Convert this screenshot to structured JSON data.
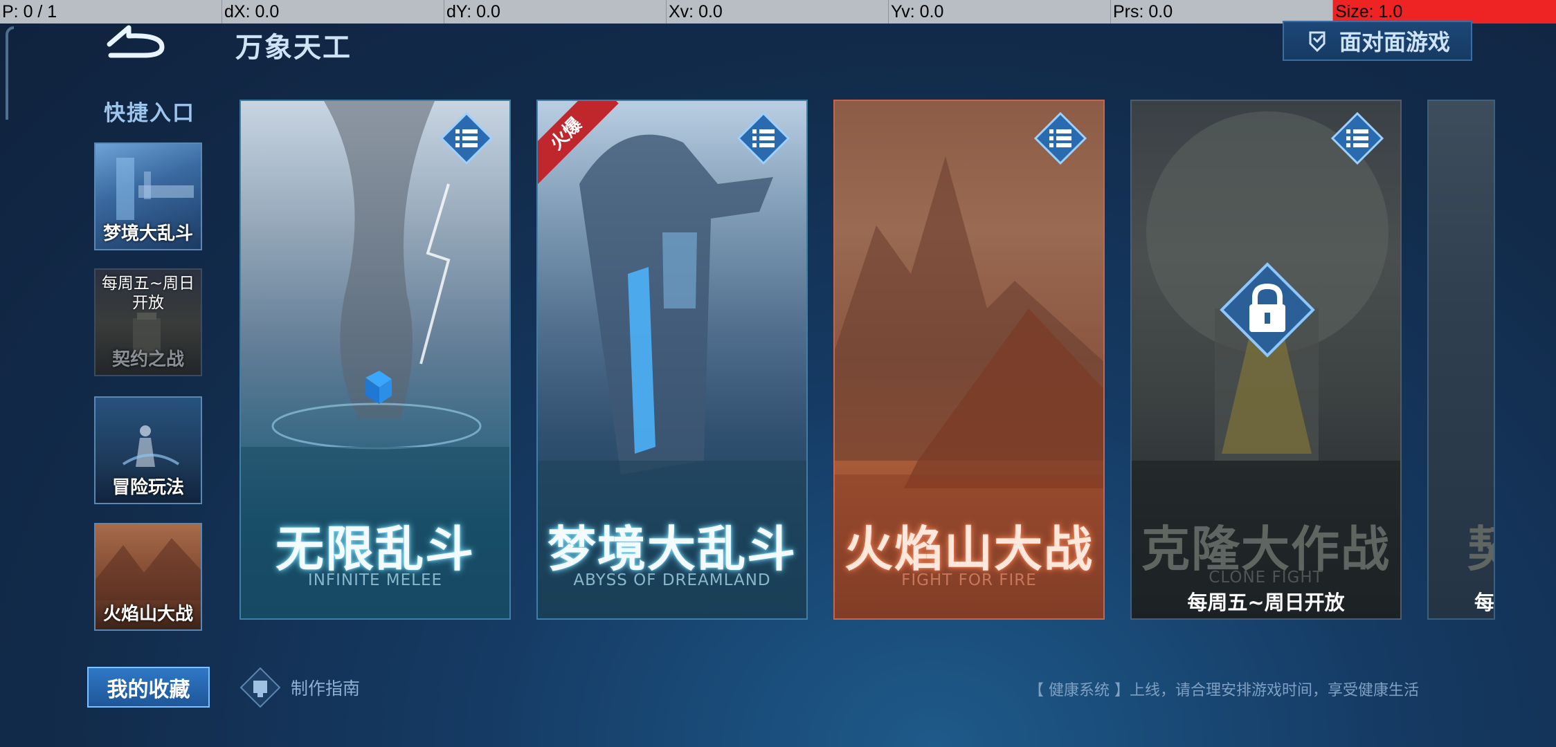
{
  "debug": {
    "p": "P: 0 / 1",
    "dx": "dX: 0.0",
    "dy": "dY: 0.0",
    "xv": "Xv: 0.0",
    "yv": "Yv: 0.0",
    "prs": "Prs: 0.0",
    "size": "Size: 1.0"
  },
  "header": {
    "title": "万象天工",
    "face_to_face_label": "面对面游戏"
  },
  "sidebar": {
    "title": "快捷入口",
    "items": [
      {
        "label": "梦境大乱斗",
        "sublabel": ""
      },
      {
        "label": "契约之战",
        "sublabel": "每周五~周日开放"
      },
      {
        "label": "冒险玩法",
        "sublabel": ""
      },
      {
        "label": "火焰山大战",
        "sublabel": ""
      }
    ],
    "favorites_label": "我的收藏",
    "guide_label": "制作指南"
  },
  "cards": [
    {
      "title": "无限乱斗",
      "subtitle": "INFINITE MELEE"
    },
    {
      "title": "梦境大乱斗",
      "subtitle": "ABYSS OF DREAMLAND",
      "badge": "火爆"
    },
    {
      "title": "火焰山大战",
      "subtitle": "FIGHT FOR FIRE"
    },
    {
      "title": "克隆大作战",
      "subtitle": "CLONE FIGHT",
      "schedule": "每周五~周日开放",
      "locked": true
    },
    {
      "title": "契",
      "schedule": "每"
    }
  ],
  "footer": {
    "notice": "【 健康系统 】上线，请合理安排游戏时间，享受健康生活"
  },
  "colors": {
    "accent": "#2f78c6",
    "hot_badge": "#c0272d"
  }
}
